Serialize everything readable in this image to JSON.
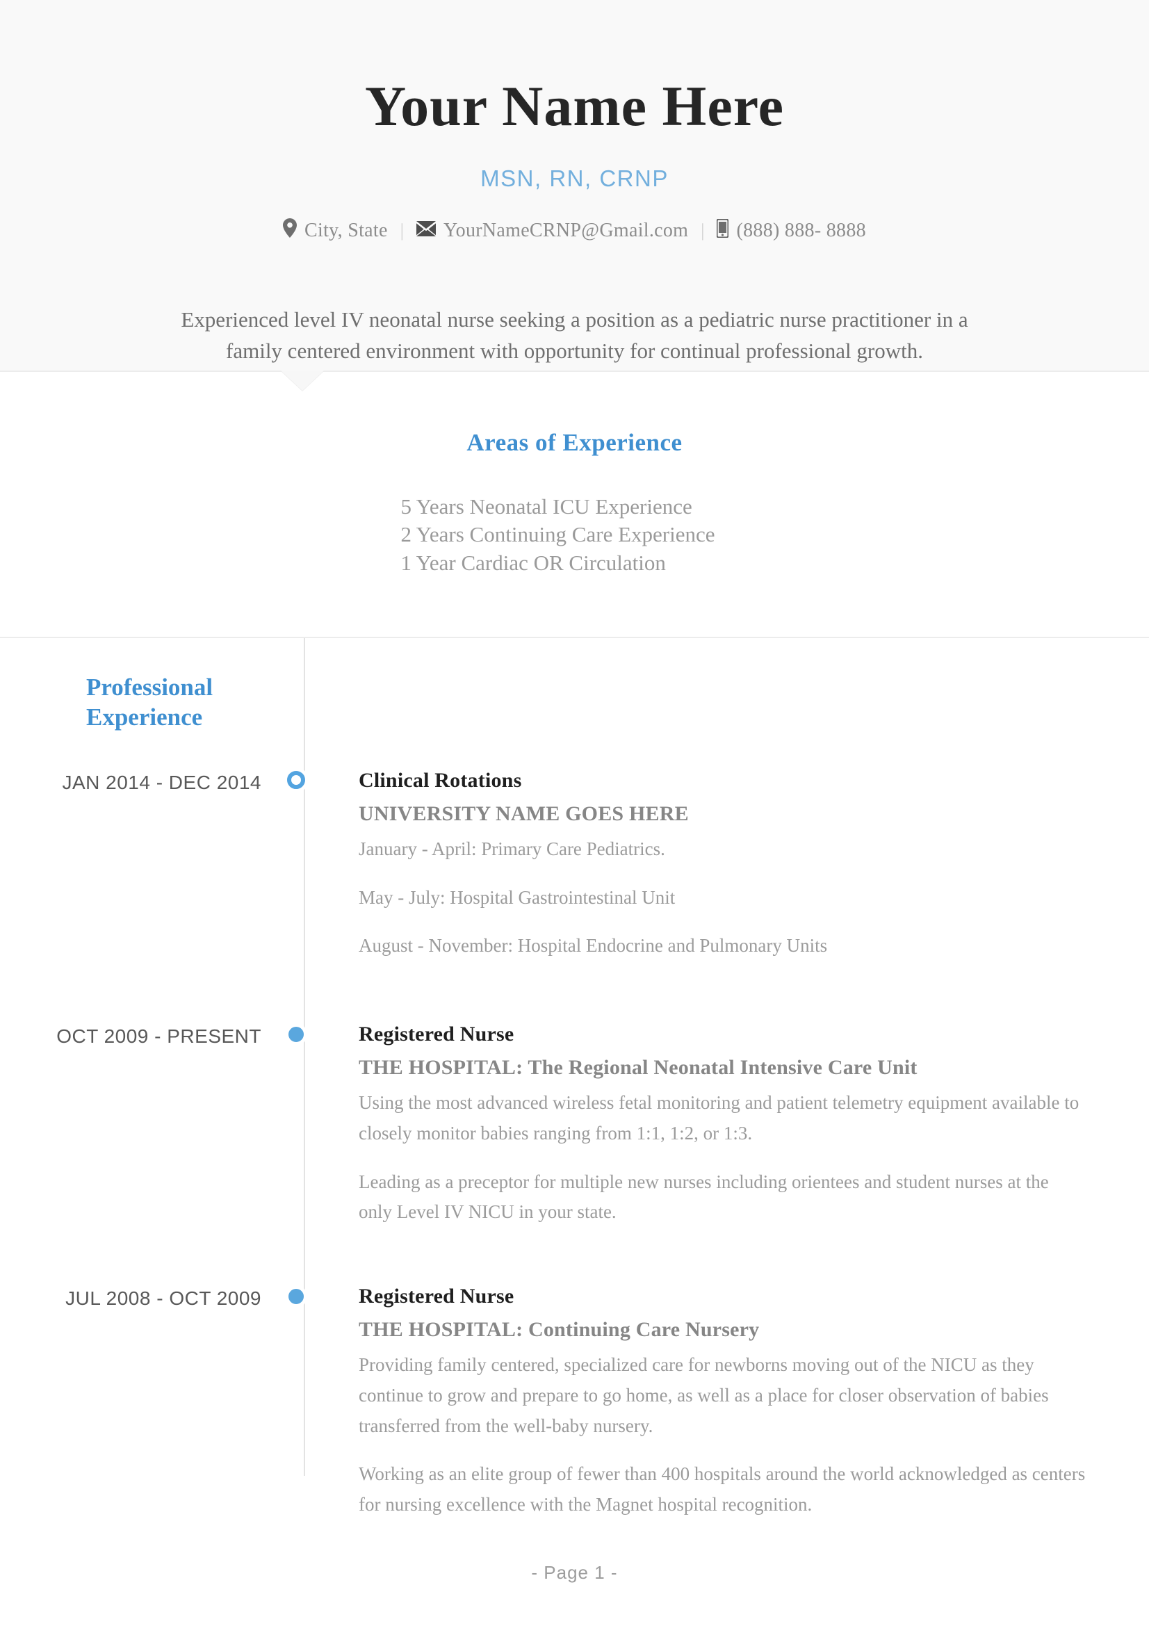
{
  "colors": {
    "accent_blue": "#3f8fd0",
    "credential_blue": "#72afdd",
    "marker_blue": "#5aa7de",
    "header_bg": "#f9f9f9",
    "body_text": "#9b9b9b",
    "heading_dark": "#1f1f1f"
  },
  "header": {
    "name": "Your Name Here",
    "credentials": "MSN, RN, CRNP",
    "contact": {
      "location_icon": "map-pin-icon",
      "location": "City, State",
      "separator": "|",
      "email_icon": "envelope-icon",
      "email": "YourNameCRNP@Gmail.com",
      "phone_icon": "mobile-phone-icon",
      "phone": "(888)  888- 8888"
    },
    "summary": "Experienced level IV neonatal nurse seeking a position as a pediatric nurse practitioner in a family centered environment with opportunity for continual professional growth."
  },
  "areas": {
    "title": "Areas of Experience",
    "items": [
      "5 Years Neonatal ICU Experience",
      "2 Years Continuing Care Experience",
      "1 Year Cardiac OR Circulation"
    ]
  },
  "experience": {
    "section_title_line1": "Professional",
    "section_title_line2": "Experience",
    "entries": [
      {
        "dates": "JAN 2014 - DEC 2014",
        "marker": "hollow",
        "role": "Clinical Rotations",
        "organization": "UNIVERSITY NAME GOES HERE",
        "bullets": [
          "January - April: Primary Care Pediatrics.",
          "May - July: Hospital Gastrointestinal Unit",
          "August - November: Hospital Endocrine and Pulmonary Units"
        ]
      },
      {
        "dates": "OCT 2009 - PRESENT",
        "marker": "filled",
        "role": "Registered Nurse",
        "organization": "THE HOSPITAL: The Regional Neonatal Intensive Care Unit",
        "bullets": [
          "Using the most advanced wireless fetal monitoring and patient telemetry equipment available to closely monitor babies ranging from 1:1, 1:2, or 1:3.",
          "Leading as a preceptor for multiple new nurses including orientees and student nurses at the only Level IV NICU in your state."
        ]
      },
      {
        "dates": "JUL 2008 - OCT 2009",
        "marker": "filled",
        "role": "Registered Nurse",
        "organization": "THE HOSPITAL: Continuing Care Nursery",
        "bullets": [
          "Providing  family centered, specialized care for newborns moving out of the NICU as they continue to grow and prepare to go home, as well as a place for closer observation of babies transferred from the well-baby nursery.",
          "Working as an elite group of fewer than 400 hospitals around the world acknowledged as centers for nursing excellence with the Magnet hospital recognition."
        ]
      }
    ]
  },
  "footer": {
    "page_label": "- Page 1 -"
  }
}
